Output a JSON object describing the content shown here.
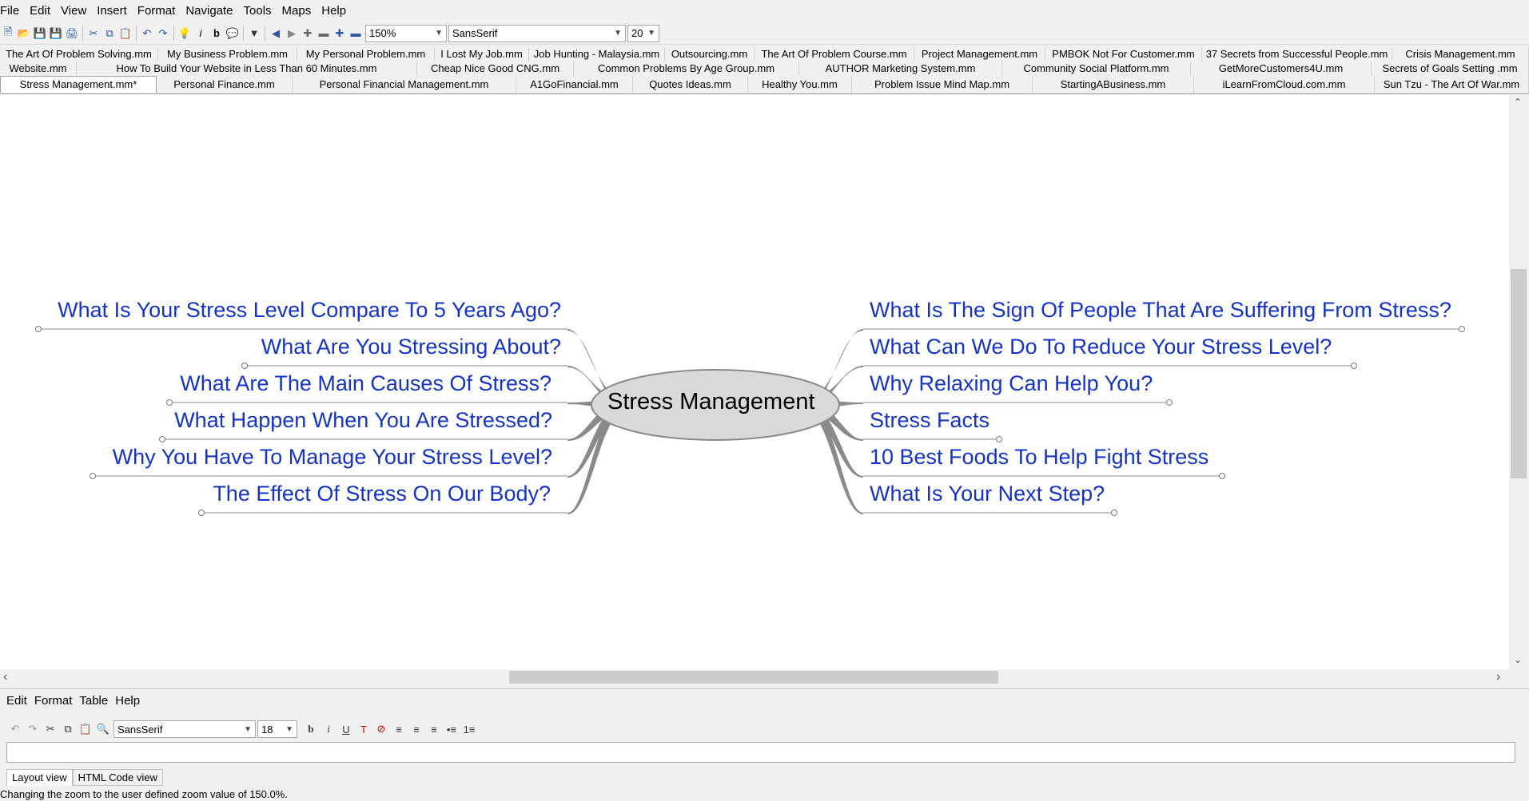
{
  "menu": [
    "File",
    "Edit",
    "View",
    "Insert",
    "Format",
    "Navigate",
    "Tools",
    "Maps",
    "Help"
  ],
  "toolbar": {
    "zoom": "150%",
    "font": "SansSerif",
    "size": "20"
  },
  "tabs": {
    "row1": [
      "The Art Of Problem Solving.mm",
      "My Business Problem.mm",
      "My Personal Problem.mm",
      "I Lost My Job.mm",
      "Job Hunting - Malaysia.mm",
      "Outsourcing.mm",
      "The Art Of Problem Course.mm",
      "Project Management.mm",
      "PMBOK Not For Customer.mm",
      "37 Secrets from Successful People.mm",
      "Crisis Management.mm"
    ],
    "row2": [
      "Website.mm",
      "How To Build Your Website in Less Than 60 Minutes.mm",
      "Cheap Nice Good CNG.mm",
      "Common Problems By Age Group.mm",
      "AUTHOR Marketing System.mm",
      "Community Social Platform.mm",
      "GetMoreCustomers4U.mm",
      "Secrets of Goals Setting .mm"
    ],
    "row3": [
      "Stress Management.mm*",
      "Personal Finance.mm",
      "Personal Financial Management.mm",
      "A1GoFinancial.mm",
      "Quotes Ideas.mm",
      "Healthy You.mm",
      "Problem Issue Mind Map.mm",
      "StartingABusiness.mm",
      "iLearnFromCloud.com.mm",
      "Sun Tzu - The Art Of War.mm"
    ]
  },
  "mindmap": {
    "root": "Stress Management",
    "left": [
      "What Is Your Stress Level Compare To 5 Years Ago?",
      "What Are You Stressing About?",
      "What Are The Main Causes Of Stress?",
      "What Happen When You Are Stressed?",
      "Why You Have To Manage Your Stress Level?",
      "The Effect Of Stress On Our Body?"
    ],
    "right": [
      "What Is The Sign Of People That Are Suffering From Stress?",
      "What Can We Do To Reduce Your Stress Level?",
      "Why Relaxing Can Help You?",
      "Stress Facts",
      "10 Best Foods To Help Fight Stress",
      "What Is Your Next Step?"
    ]
  },
  "editor": {
    "menu": [
      "Edit",
      "Format",
      "Table",
      "Help"
    ],
    "font": "SansSerif",
    "size": "18",
    "views": [
      "Layout view",
      "HTML Code view"
    ]
  },
  "status": "Changing the zoom to the user defined zoom value of 150.0%."
}
